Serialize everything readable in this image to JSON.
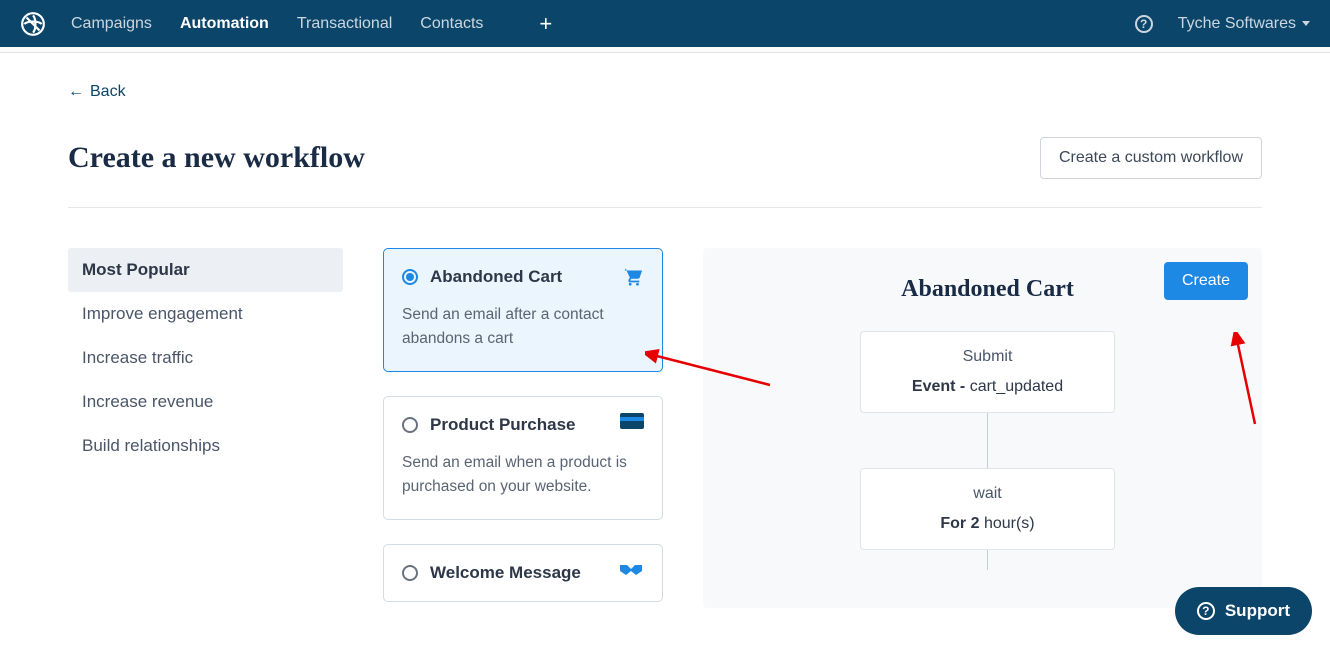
{
  "nav": {
    "items": [
      "Campaigns",
      "Automation",
      "Transactional",
      "Contacts"
    ],
    "active_index": 1,
    "account_label": "Tyche Softwares"
  },
  "back_label": "Back",
  "page_title": "Create a new workflow",
  "custom_button": "Create a custom workflow",
  "sidebar": {
    "items": [
      "Most Popular",
      "Improve engagement",
      "Increase traffic",
      "Increase revenue",
      "Build relationships"
    ],
    "active_index": 0
  },
  "cards": [
    {
      "title": "Abandoned Cart",
      "desc": "Send an email after a contact abandons a cart",
      "icon": "cart-icon",
      "selected": true
    },
    {
      "title": "Product Purchase",
      "desc": "Send an email when a product is purchased on your website.",
      "icon": "creditcard-icon",
      "selected": false
    },
    {
      "title": "Welcome Message",
      "desc": "",
      "icon": "handshake-icon",
      "selected": false
    }
  ],
  "preview": {
    "title": "Abandoned Cart",
    "create_label": "Create",
    "nodes": [
      {
        "title": "Submit",
        "sub_bold": "Event - ",
        "sub_text": "cart_updated"
      },
      {
        "title": "wait",
        "sub_bold": "For 2 ",
        "sub_text": "hour(s)"
      }
    ]
  },
  "support_label": "Support"
}
